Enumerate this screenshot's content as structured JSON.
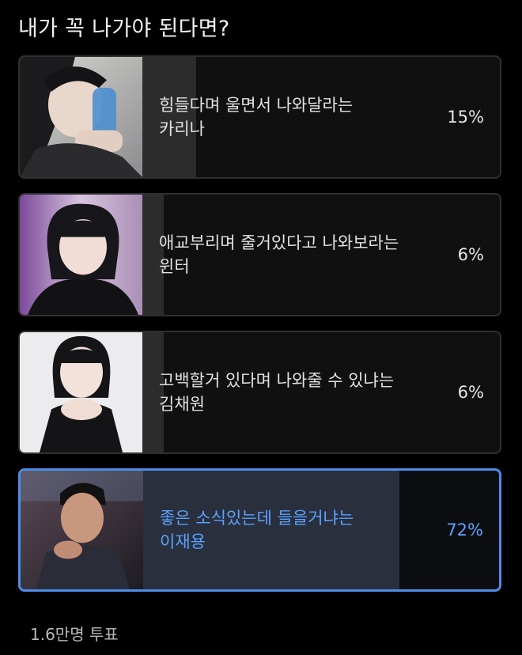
{
  "poll": {
    "title": "내가 꼭 나가야 된다면?",
    "options": [
      {
        "text": "힘들다며 울면서 나와달라는\n카리나",
        "percent_label": "15%",
        "percent": 15,
        "selected": false
      },
      {
        "text": "애교부리며 줄거있다고 나와보라는\n윈터",
        "percent_label": "6%",
        "percent": 6,
        "selected": false
      },
      {
        "text": "고백할거 있다며 나와줄 수 있냐는\n김채원",
        "percent_label": "6%",
        "percent": 6,
        "selected": false
      },
      {
        "text": "좋은 소식있는데 들을거냐는\n이재용",
        "percent_label": "72%",
        "percent": 72,
        "selected": true
      }
    ],
    "vote_count": "1.6만명 투표"
  },
  "colors": {
    "background": "#000000",
    "option_border": "#2f2f2f",
    "result_bar": "#2c2c2c",
    "selected_accent": "#4b8de6",
    "selected_text": "#5aa2ff"
  }
}
